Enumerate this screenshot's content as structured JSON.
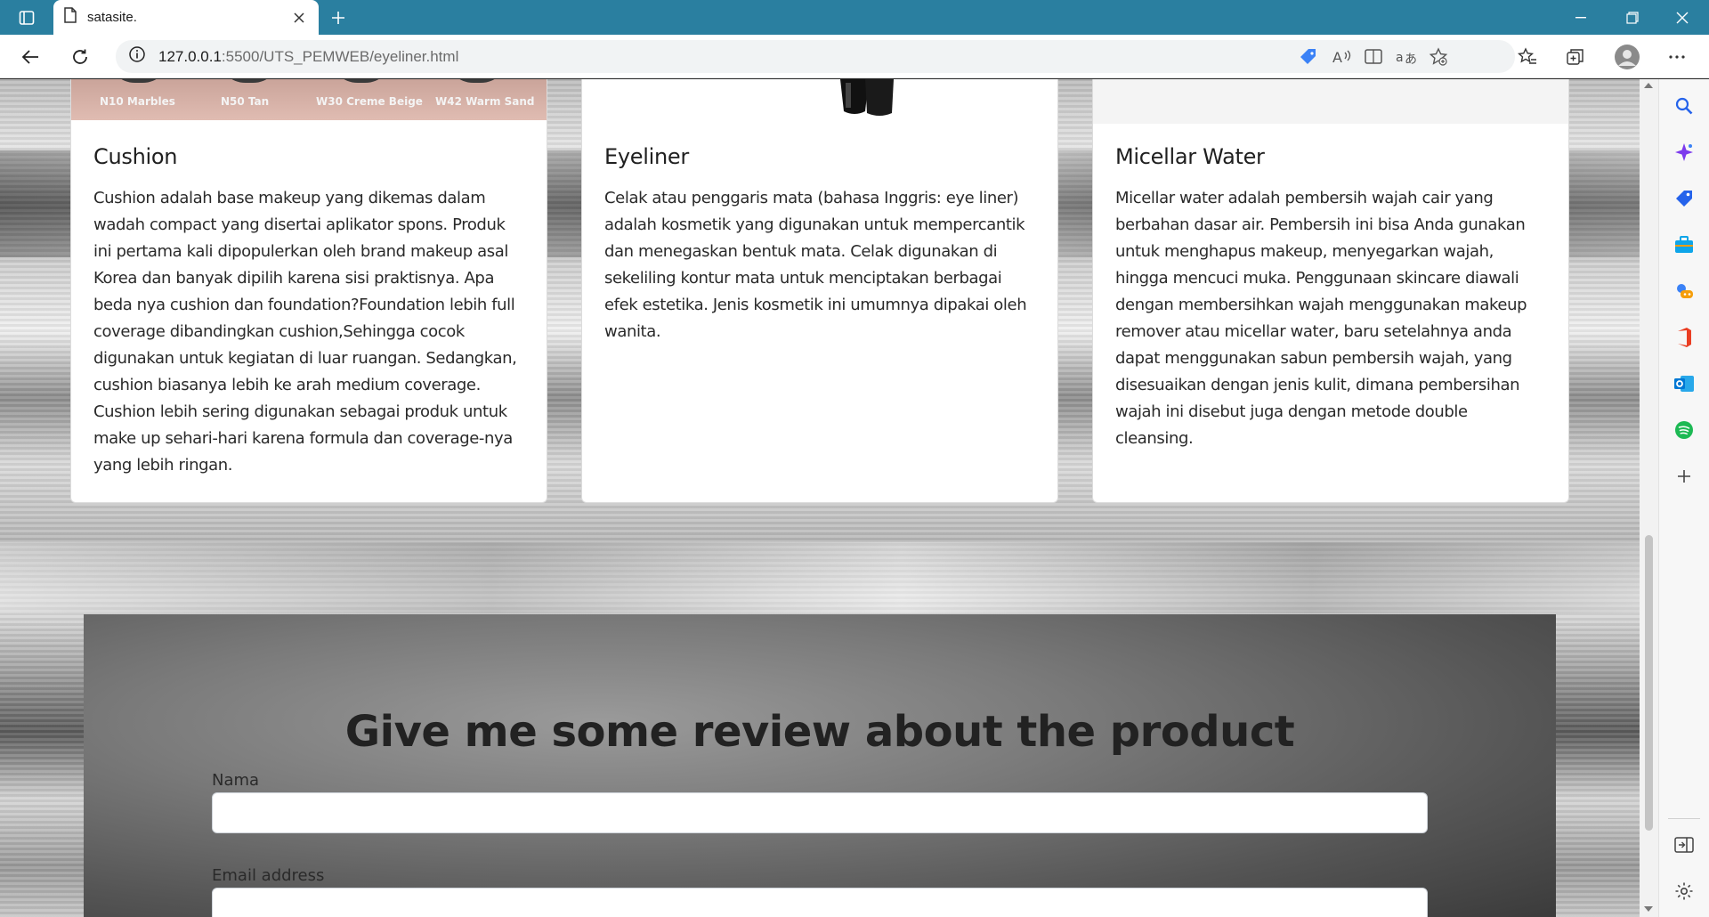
{
  "browser": {
    "tab_title": "satasite.",
    "url_host": "127.0.0.1",
    "url_rest": ":5500/UTS_PEMWEB/eyeliner.html",
    "icons": [
      "tab-actions-icon",
      "page-icon",
      "close-icon",
      "plus-icon",
      "minimize-icon",
      "restore-icon",
      "close-window-icon",
      "back-icon",
      "refresh-icon",
      "info-icon",
      "coupon-icon",
      "read-aloud-icon",
      "immersive-reader-icon",
      "translate-icon",
      "favorite-add-icon",
      "favorites-icon",
      "collections-icon",
      "profile-icon",
      "more-icon"
    ]
  },
  "sidebar": {
    "icons": [
      "search-icon",
      "copilot-icon",
      "shopping-icon",
      "tools-icon",
      "games-icon",
      "office-icon",
      "outlook-icon",
      "spotify-icon",
      "add-icon",
      "split-screen-icon",
      "settings-icon"
    ]
  },
  "cards": [
    {
      "title": "Cushion",
      "text": "Cushion adalah base makeup yang dikemas dalam wadah compact yang disertai aplikator spons. Produk ini pertama kali dipopulerkan oleh brand makeup asal Korea dan banyak dipilih karena sisi praktisnya. Apa beda nya cushion dan foundation?Foundation lebih full coverage dibandingkan cushion,Sehingga cocok digunakan untuk kegiatan di luar ruangan. Sedangkan, cushion biasanya lebih ke arah medium coverage. Cushion lebih sering digunakan sebagai produk untuk make up sehari-hari karena formula dan coverage-nya yang lebih ringan.",
      "swatches": [
        "N10 Marbles",
        "N50 Tan",
        "W30 Creme Beige",
        "W42 Warm Sand"
      ]
    },
    {
      "title": "Eyeliner",
      "text": "Celak atau penggaris mata (bahasa Inggris: eye liner) adalah kosmetik yang digunakan untuk mempercantik dan menegaskan bentuk mata. Celak digunakan di sekeliling kontur mata untuk menciptakan berbagai efek estetika. Jenis kosmetik ini umumnya dipakai oleh wanita."
    },
    {
      "title": "Micellar Water",
      "text": "Micellar water adalah pembersih wajah cair yang berbahan dasar air. Pembersih ini bisa Anda gunakan untuk menghapus makeup, menyegarkan wajah, hingga mencuci muka. Penggunaan skincare diawali dengan membersihkan wajah menggunakan makeup remover atau micellar water, baru setelahnya anda dapat menggunakan sabun pembersih wajah, yang disesuaikan dengan jenis kulit, dimana pembersihan wajah ini disebut juga dengan metode double cleansing."
    }
  ],
  "review": {
    "title": "Give me some review about the product",
    "name_label": "Nama",
    "name_value": "",
    "email_label": "Email address",
    "email_value": ""
  }
}
